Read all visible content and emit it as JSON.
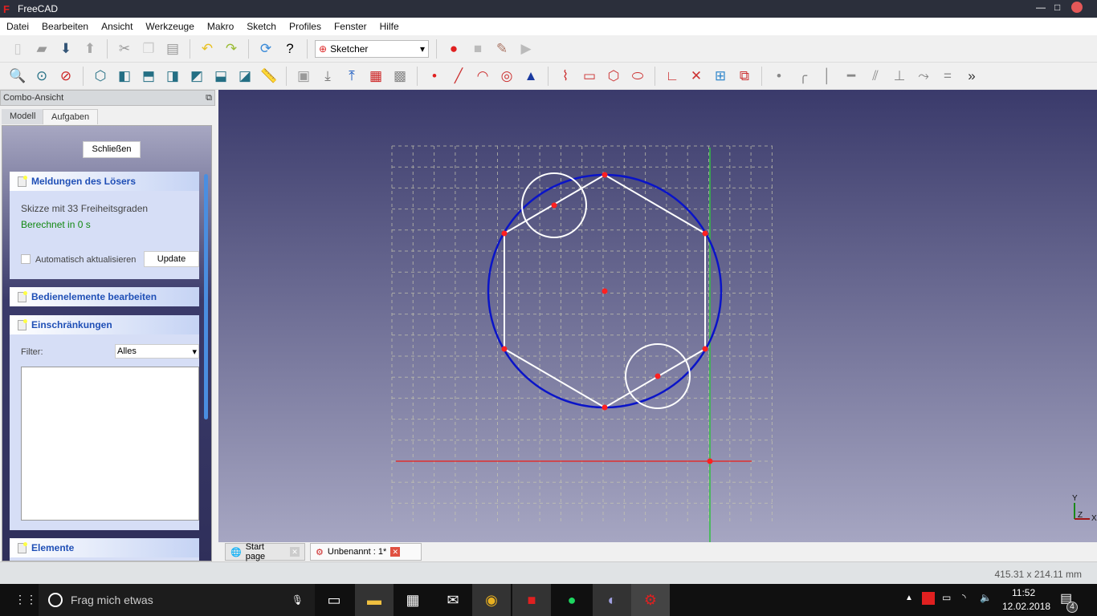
{
  "window": {
    "title": "FreeCAD",
    "app_logo": "Fc"
  },
  "menu": [
    "Datei",
    "Bearbeiten",
    "Ansicht",
    "Werkzeuge",
    "Makro",
    "Sketch",
    "Profiles",
    "Fenster",
    "Hilfe"
  ],
  "toolbar": {
    "workbench": "Sketcher"
  },
  "combo": {
    "title": "Combo-Ansicht",
    "tabs": [
      "Modell",
      "Aufgaben"
    ],
    "close_label": "Schließen",
    "solver": {
      "title": "Meldungen des Lösers",
      "dof": "Skizze mit 33 Freiheitsgraden",
      "solved": "Berechnet in 0 s",
      "auto_update": "Automatisch aktualisieren",
      "update": "Update"
    },
    "edit_controls": "Bedienelemente bearbeiten",
    "constraints": {
      "title": "Einschränkungen",
      "filter_label": "Filter:",
      "filter_value": "Alles"
    },
    "elements": "Elemente"
  },
  "doc_tabs": [
    "Start page",
    "Unbenannt : 1*"
  ],
  "status": {
    "dimensions": "415.31 x 214.11 mm"
  },
  "axis": {
    "x": "X",
    "y": "Y",
    "z": "Z"
  },
  "taskbar": {
    "search": "Frag mich etwas",
    "time": "11:52",
    "date": "12.02.2018",
    "notifications": "4"
  },
  "colors": {
    "circle": "#0a14c8",
    "points": "#ff2020",
    "v_axis": "#30c040",
    "h_axis": "#e03030"
  }
}
